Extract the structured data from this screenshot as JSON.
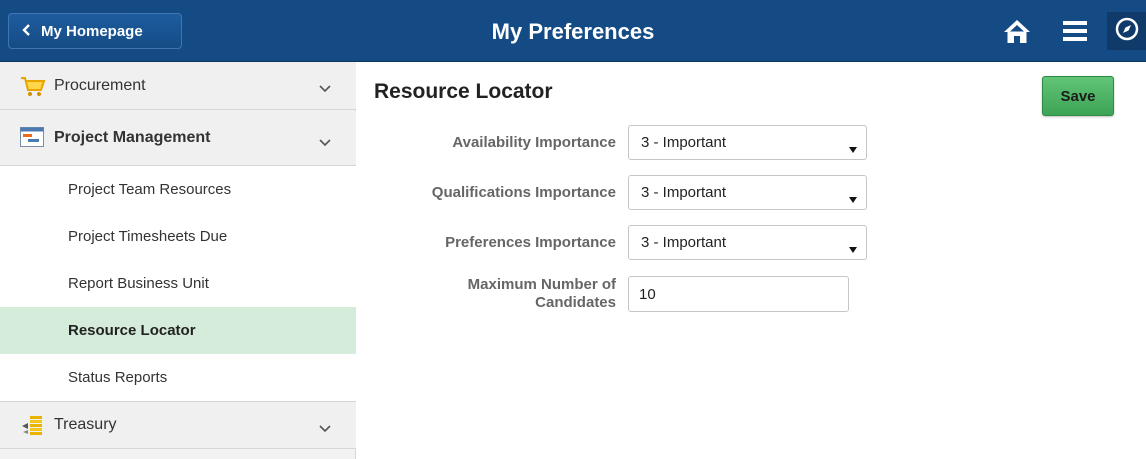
{
  "header": {
    "home_label": "My Homepage",
    "title": "My Preferences",
    "icons": [
      "chevron-left-icon",
      "home-icon",
      "menu-icon",
      "navigator-icon"
    ]
  },
  "sidebar": {
    "categories": [
      {
        "label": "Procurement",
        "icon": "shopping-cart-icon"
      },
      {
        "label": "Project Management",
        "icon": "project-gantt-icon"
      },
      {
        "label": "Treasury",
        "icon": "treasury-coins-icon"
      }
    ],
    "items": [
      {
        "label": "Project Team Resources"
      },
      {
        "label": "Project Timesheets Due"
      },
      {
        "label": "Report Business Unit"
      },
      {
        "label": "Resource Locator"
      },
      {
        "label": "Status Reports"
      }
    ]
  },
  "main": {
    "title": "Resource Locator",
    "save_label": "Save",
    "fields": [
      {
        "label": "Availability Importance",
        "value": "3 - Important"
      },
      {
        "label": "Qualifications Importance",
        "value": "3 - Important"
      },
      {
        "label": "Preferences Importance",
        "value": "3 - Important"
      }
    ],
    "max_candidates": {
      "label_line1": "Maximum Number of",
      "label_line2": "Candidates",
      "value": "10"
    }
  },
  "colors": {
    "header": "#154b85",
    "active_item": "#d4ecd9",
    "save_button": "#4cb362",
    "sidebar": "#f2f2f2"
  }
}
